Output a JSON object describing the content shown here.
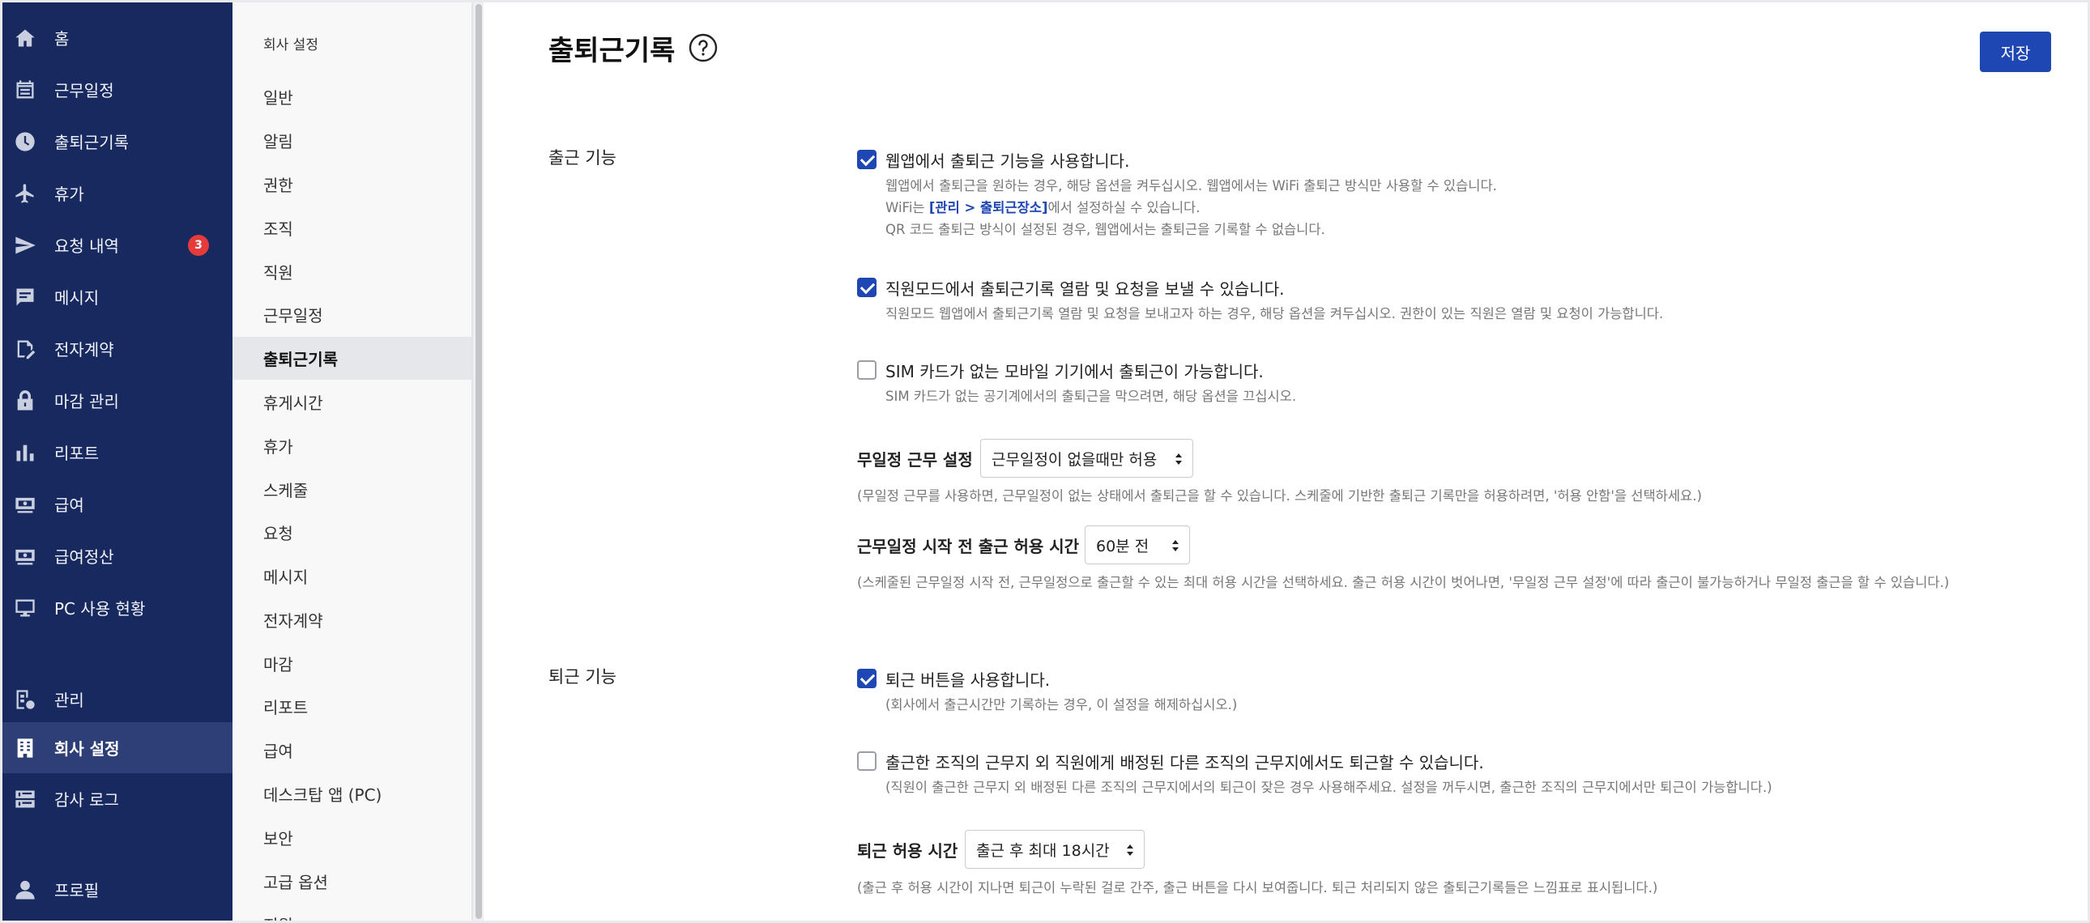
{
  "nav": {
    "items": [
      {
        "label": "홈",
        "icon": "home-icon"
      },
      {
        "label": "근무일정",
        "icon": "calendar-icon"
      },
      {
        "label": "출퇴근기록",
        "icon": "clock-icon"
      },
      {
        "label": "휴가",
        "icon": "airplane-icon"
      },
      {
        "label": "요청 내역",
        "icon": "paper-plane-icon",
        "badge": "3"
      },
      {
        "label": "메시지",
        "icon": "message-icon"
      },
      {
        "label": "전자계약",
        "icon": "contract-icon"
      },
      {
        "label": "마감 관리",
        "icon": "lock-icon"
      },
      {
        "label": "리포트",
        "icon": "bar-chart-icon"
      },
      {
        "label": "급여",
        "icon": "payroll-icon"
      },
      {
        "label": "급여정산",
        "icon": "payroll-settlement-icon"
      },
      {
        "label": "PC 사용 현황",
        "icon": "monitor-icon"
      },
      {
        "label": "관리",
        "icon": "admin-icon"
      },
      {
        "label": "회사 설정",
        "icon": "building-icon",
        "active": true
      },
      {
        "label": "감사 로그",
        "icon": "audit-log-icon"
      },
      {
        "label": "프로필",
        "icon": "user-icon"
      }
    ]
  },
  "subnav": {
    "title": "회사 설정",
    "items": [
      "일반",
      "알림",
      "권한",
      "조직",
      "직원",
      "근무일정",
      "출퇴근기록",
      "휴게시간",
      "휴가",
      "스케줄",
      "요청",
      "메시지",
      "전자계약",
      "마감",
      "리포트",
      "급여",
      "데스크탑 앱 (PC)",
      "보안",
      "고급 옵션",
      "지원"
    ],
    "active_index": 6
  },
  "header": {
    "title": "출퇴근기록",
    "save_label": "저장"
  },
  "clock_in": {
    "section_label": "출근 기능",
    "web_app": {
      "checked": true,
      "label": "웹앱에서 출퇴근 기능을 사용합니다.",
      "desc1": "웹앱에서 출퇴근을 원하는 경우, 해당 옵션을 켜두십시오. 웹앱에서는 WiFi 출퇴근 방식만 사용할 수 있습니다.",
      "desc2_prefix": "WiFi는 ",
      "desc2_link": "[관리 > 출퇴근장소]",
      "desc2_suffix": "에서 설정하실 수 있습니다.",
      "desc3": "QR 코드 출퇴근 방식이 설정된 경우, 웹앱에서는 출퇴근을 기록할 수 없습니다."
    },
    "employee_mode": {
      "checked": true,
      "label": "직원모드에서 출퇴근기록 열람 및 요청을 보낼 수 있습니다.",
      "desc": "직원모드 웹앱에서 출퇴근기록 열람 및 요청을 보내고자 하는 경우, 해당 옵션을 켜두십시오. 권한이 있는 직원은 열람 및 요청이 가능합니다."
    },
    "no_sim": {
      "checked": false,
      "label": "SIM 카드가 없는 모바일 기기에서 출퇴근이 가능합니다.",
      "desc": "SIM 카드가 없는 공기계에서의 출퇴근을 막으려면, 해당 옵션을 끄십시오."
    },
    "unscheduled": {
      "label": "무일정 근무 설정",
      "value": "근무일정이 없을때만 허용",
      "note": "(무일정 근무를 사용하면, 근무일정이 없는 상태에서 출퇴근을 할 수 있습니다. 스케줄에 기반한 출퇴근 기록만을 허용하려면, '허용 안함'을 선택하세요.)"
    },
    "early_allow": {
      "label": "근무일정 시작 전 출근 허용 시간",
      "value": "60분 전",
      "note": "(스케줄된 근무일정 시작 전, 근무일정으로 출근할 수 있는 최대 허용 시간을 선택하세요. 출근 허용 시간이 벗어나면, '무일정 근무 설정'에 따라 출근이 불가능하거나 무일정 출근을 할 수 있습니다.)"
    }
  },
  "clock_out": {
    "section_label": "퇴근 기능",
    "button": {
      "checked": true,
      "label": "퇴근 버튼을 사용합니다.",
      "desc": "(회사에서 출근시간만 기록하는 경우, 이 설정을 해제하십시오.)"
    },
    "other_org": {
      "checked": false,
      "label": "출근한 조직의 근무지 외 직원에게 배정된 다른 조직의 근무지에서도 퇴근할 수 있습니다.",
      "desc": "(직원이 출근한 근무지 외 배정된 다른 조직의 근무지에서의 퇴근이 잦은 경우 사용해주세요. 설정을 꺼두시면, 출근한 조직의 근무지에서만 퇴근이 가능합니다.)"
    },
    "allow_time": {
      "label": "퇴근 허용 시간",
      "value": "출근 후 최대 18시간",
      "note": "(출근 후 허용 시간이 지나면 퇴근이 누락된 걸로 간주, 출근 버튼을 다시 보여줍니다. 퇴근 처리되지 않은 출퇴근기록들은 느낌표로 표시됩니다.)"
    }
  }
}
